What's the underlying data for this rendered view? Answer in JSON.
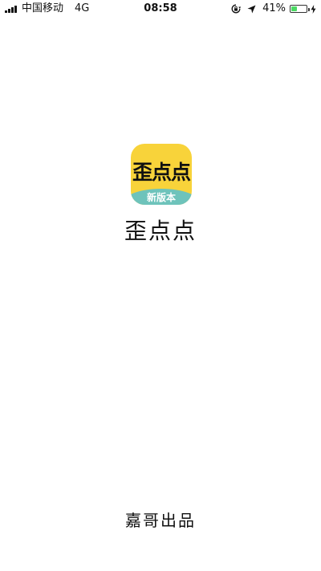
{
  "status_bar": {
    "carrier": "中国移动",
    "network": "4G",
    "time": "08:58",
    "battery_percent": "41%",
    "battery_level": 0.41,
    "battery_color": "#4cd964",
    "icons": [
      "signal-bars-icon",
      "rotation-lock-icon",
      "location-arrow-icon",
      "battery-icon",
      "charging-bolt-icon"
    ]
  },
  "app_icon": {
    "title": "歪点点",
    "badge": "新版本",
    "background_color": "#f8d33a",
    "band_color": "#6ec3bb"
  },
  "app_name": "歪点点",
  "footer": {
    "credit": "嘉哥出品"
  }
}
